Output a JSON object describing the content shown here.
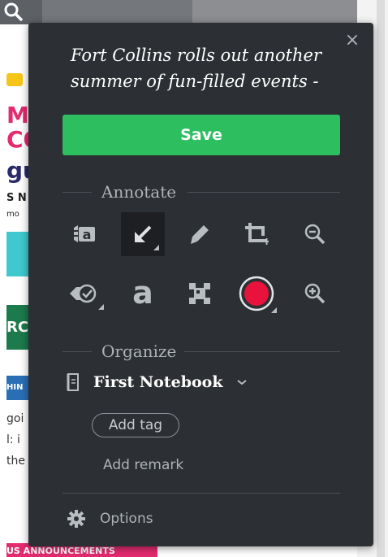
{
  "background": {
    "side_texts": [
      "MU",
      "CO",
      "gu",
      "S N",
      "mo",
      "RC",
      "HIN",
      "goi",
      "l: i",
      "the"
    ],
    "bottom_banner": "US ANNOUNCEMENTS"
  },
  "clipper": {
    "close_icon": "×",
    "title": "Fort Collins rolls out another summer of fun-filled events -",
    "save_label": "Save",
    "annotate": {
      "heading": "Annotate",
      "tools": [
        {
          "name": "highlight-text",
          "icon": "text-highlight-icon"
        },
        {
          "name": "arrow",
          "icon": "arrow-icon",
          "active": true
        },
        {
          "name": "pen",
          "icon": "pen-icon"
        },
        {
          "name": "crop",
          "icon": "crop-icon"
        },
        {
          "name": "zoom-out",
          "icon": "zoom-out-icon"
        },
        {
          "name": "stamp",
          "icon": "stamp-icon"
        },
        {
          "name": "text",
          "icon": "text-icon",
          "glyph": "a"
        },
        {
          "name": "pixelate",
          "icon": "pixelate-icon"
        },
        {
          "name": "color",
          "icon": "color-picker-icon",
          "color": "#e8123c"
        },
        {
          "name": "zoom-in",
          "icon": "zoom-in-icon"
        }
      ]
    },
    "organize": {
      "heading": "Organize",
      "notebook": "First Notebook",
      "add_tag": "Add tag",
      "add_remark": "Add remark"
    },
    "options_label": "Options",
    "colors": {
      "panel": "#2c2f33",
      "save": "#2dbe60",
      "record": "#e8123c"
    }
  }
}
